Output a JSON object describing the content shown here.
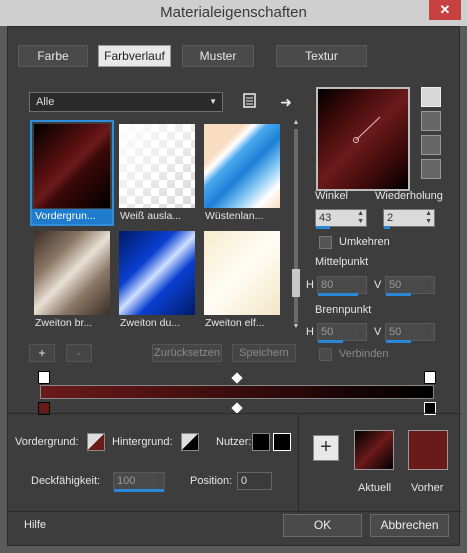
{
  "window": {
    "title": "Materialeigenschaften",
    "close": "✕"
  },
  "tabs": [
    "Farbe",
    "Farbverlauf",
    "Muster",
    "Textur"
  ],
  "filter": {
    "value": "Alle"
  },
  "gradients": [
    {
      "label": "Vordergrun...",
      "selected": true
    },
    {
      "label": "Weiß ausla..."
    },
    {
      "label": "Wüstenlan..."
    },
    {
      "label": "Zweiton br..."
    },
    {
      "label": "Zweiton du..."
    },
    {
      "label": "Zweiton elf..."
    }
  ],
  "list_buttons": {
    "add": "+",
    "remove": "-",
    "reset": "Zurücksetzen",
    "save": "Speichern"
  },
  "angle": {
    "label": "Winkel",
    "value": "43"
  },
  "repeat": {
    "label": "Wiederholung",
    "value": "2"
  },
  "invert": {
    "label": "Umkehren"
  },
  "center": {
    "label": "Mittelpunkt",
    "h_label": "H",
    "h_value": "80",
    "v_label": "V",
    "v_value": "50"
  },
  "focus": {
    "label": "Brennpunkt",
    "h_label": "H",
    "h_value": "50",
    "v_label": "V",
    "v_value": "50"
  },
  "link": {
    "label": "Verbinden"
  },
  "bottom": {
    "foreground_label": "Vordergrund:",
    "background_label": "Hintergrund:",
    "user_label": "Nutzer:",
    "opacity_label": "Deckfähigkeit:",
    "opacity_value": "100",
    "position_label": "Position:",
    "position_value": "0"
  },
  "swatches": {
    "current_label": "Aktuell",
    "previous_label": "Vorher"
  },
  "footer": {
    "help": "Hilfe",
    "ok": "OK",
    "cancel": "Abbrechen"
  },
  "colors": {
    "accent": "#2b88d8",
    "dark_red": "#6b1a1a",
    "gradient_end": "#000000"
  }
}
